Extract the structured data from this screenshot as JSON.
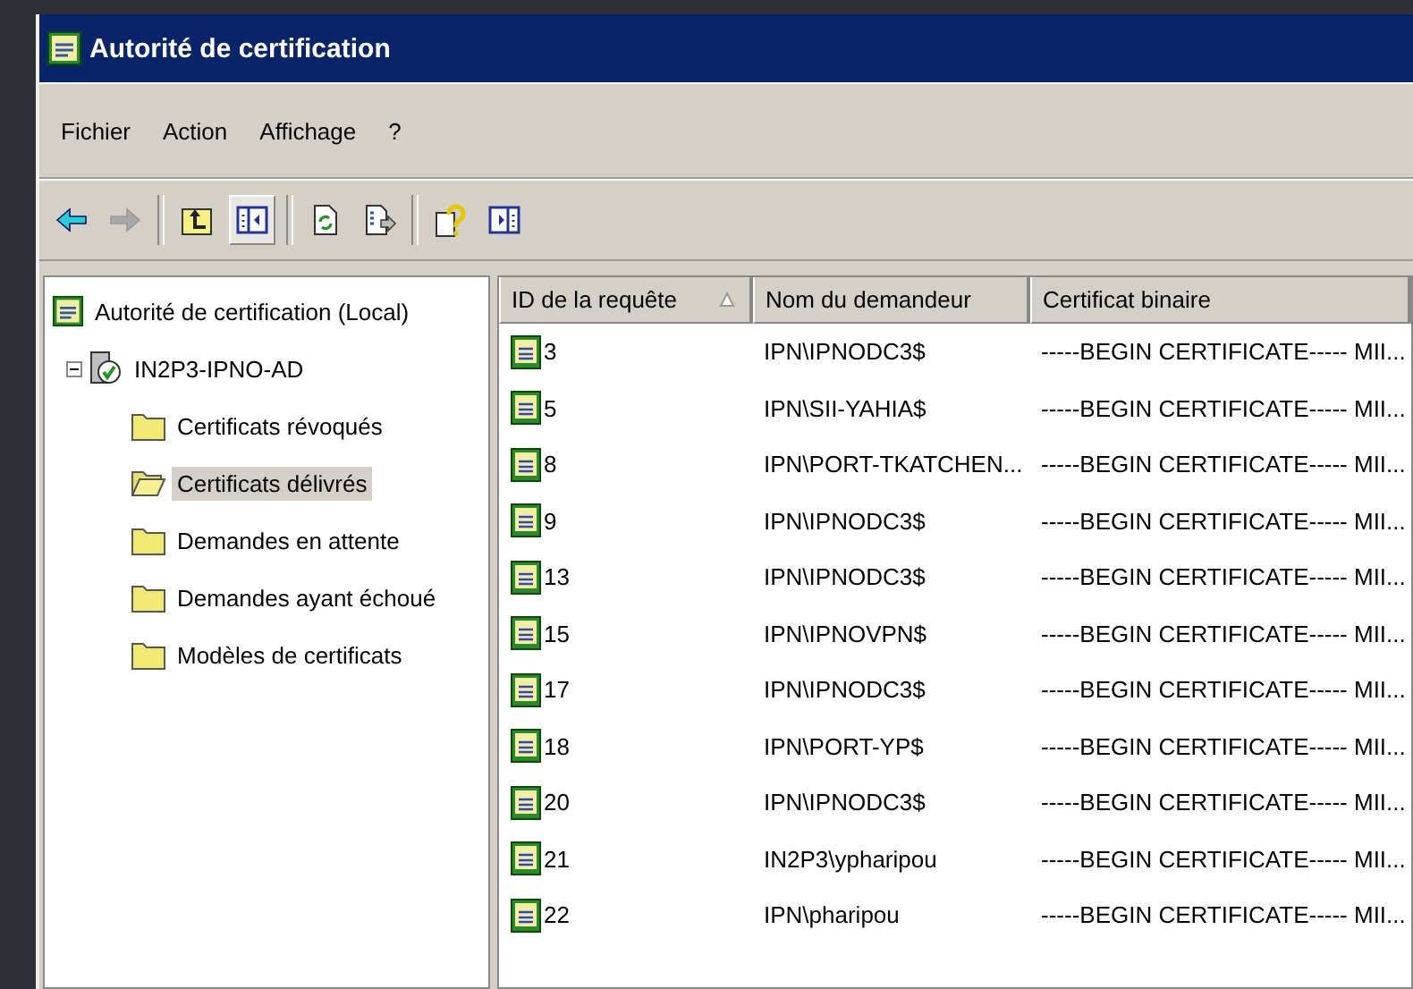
{
  "window": {
    "title": "Autorité de certification"
  },
  "menu": [
    "Fichier",
    "Action",
    "Affichage",
    "?"
  ],
  "toolbar": [
    {
      "kind": "back",
      "disabled": false
    },
    {
      "kind": "forward",
      "disabled": true
    },
    {
      "kind": "sep"
    },
    {
      "kind": "up"
    },
    {
      "kind": "tree-toggle",
      "selected": true
    },
    {
      "kind": "sep"
    },
    {
      "kind": "refresh"
    },
    {
      "kind": "export"
    },
    {
      "kind": "sep"
    },
    {
      "kind": "help"
    },
    {
      "kind": "action-pane"
    }
  ],
  "tree": [
    {
      "label": "Autorité de certification (Local)",
      "selected": false,
      "children": [
        {
          "label": "IN2P3-IPNO-AD",
          "expanded": true,
          "selected": false,
          "children": [
            {
              "label": "Certificats révoqués",
              "selected": false
            },
            {
              "label": "Certificats délivrés",
              "selected": true
            },
            {
              "label": "Demandes en attente",
              "selected": false
            },
            {
              "label": "Demandes ayant échoué",
              "selected": false
            },
            {
              "label": "Modèles de certificats",
              "selected": false
            }
          ]
        }
      ]
    }
  ],
  "table": {
    "columns": [
      {
        "label": "ID de la requête",
        "sorted": true
      },
      {
        "label": "Nom du demandeur",
        "sorted": false
      },
      {
        "label": "Certificat binaire",
        "sorted": false
      }
    ],
    "rows": [
      [
        "3",
        "IPN\\IPNODC3$",
        "-----BEGIN CERTIFICATE-----  MII..."
      ],
      [
        "5",
        "IPN\\SII-YAHIA$",
        "-----BEGIN CERTIFICATE-----  MII..."
      ],
      [
        "8",
        "IPN\\PORT-TKATCHEN...",
        "-----BEGIN CERTIFICATE-----  MII..."
      ],
      [
        "9",
        "IPN\\IPNODC3$",
        "-----BEGIN CERTIFICATE-----  MII..."
      ],
      [
        "13",
        "IPN\\IPNODC3$",
        "-----BEGIN CERTIFICATE-----  MII..."
      ],
      [
        "15",
        "IPN\\IPNOVPN$",
        "-----BEGIN CERTIFICATE-----  MII..."
      ],
      [
        "17",
        "IPN\\IPNODC3$",
        "-----BEGIN CERTIFICATE-----  MII..."
      ],
      [
        "18",
        "IPN\\PORT-YP$",
        "-----BEGIN CERTIFICATE-----  MII..."
      ],
      [
        "20",
        "IPN\\IPNODC3$",
        "-----BEGIN CERTIFICATE-----  MII..."
      ],
      [
        "21",
        "IN2P3\\ypharipou",
        "-----BEGIN CERTIFICATE-----  MII..."
      ],
      [
        "22",
        "IPN\\pharipou",
        "-----BEGIN CERTIFICATE-----  MII..."
      ]
    ]
  }
}
